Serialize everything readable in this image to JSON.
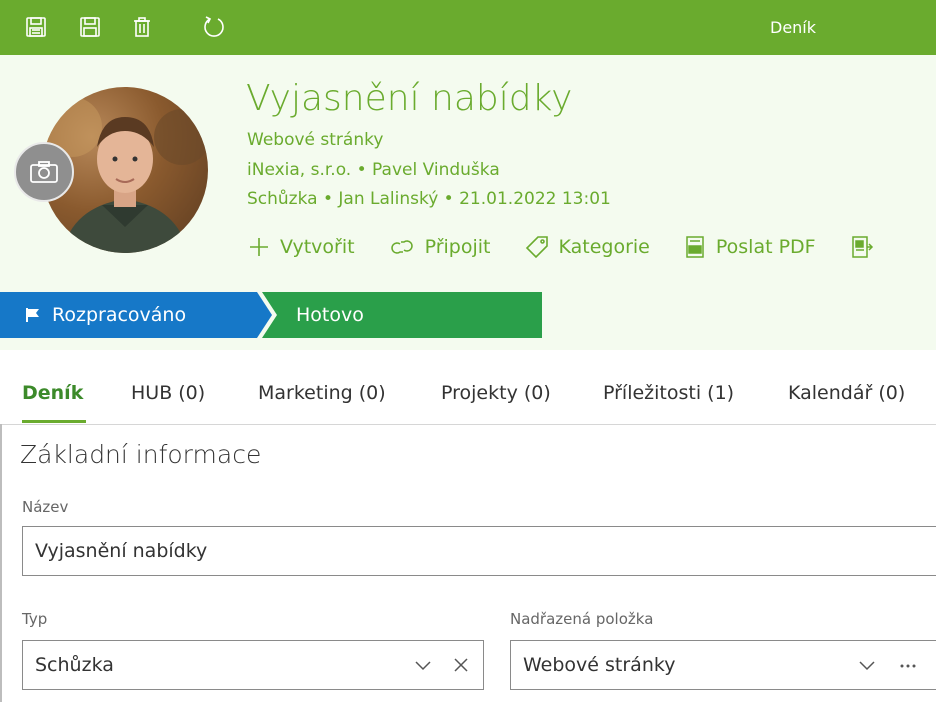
{
  "topbar": {
    "title": "Deník",
    "icons": [
      "save-close-icon",
      "save-icon",
      "delete-icon",
      "refresh-icon"
    ],
    "color": "#6aab2e"
  },
  "record": {
    "title": "Vyjasnění nabídky",
    "parent": "Webové stránky",
    "company_line": "iNexia, s.r.o. • Pavel Vinduška",
    "meta_line": "Schůzka • Jan Lalinský • 21.01.2022 13:01"
  },
  "actions": {
    "create": "Vytvořit",
    "connect": "Připojit",
    "category": "Kategorie",
    "send_pdf": "Poslat PDF"
  },
  "stages": [
    {
      "label": "Rozpracováno",
      "color": "#1678c8"
    },
    {
      "label": "Hotovo",
      "color": "#2a9f4a"
    }
  ],
  "tabs": [
    {
      "label": "Deník"
    },
    {
      "label": "HUB (0)"
    },
    {
      "label": "Marketing (0)"
    },
    {
      "label": "Projekty (0)"
    },
    {
      "label": "Příležitosti (1)"
    },
    {
      "label": "Kalendář (0)"
    }
  ],
  "form": {
    "section_title": "Základní informace",
    "name_label": "Název",
    "name_value": "Vyjasnění nabídky",
    "type_label": "Typ",
    "type_value": "Schůzka",
    "parent_label": "Nadřazená položka",
    "parent_value": "Webové stránky"
  }
}
